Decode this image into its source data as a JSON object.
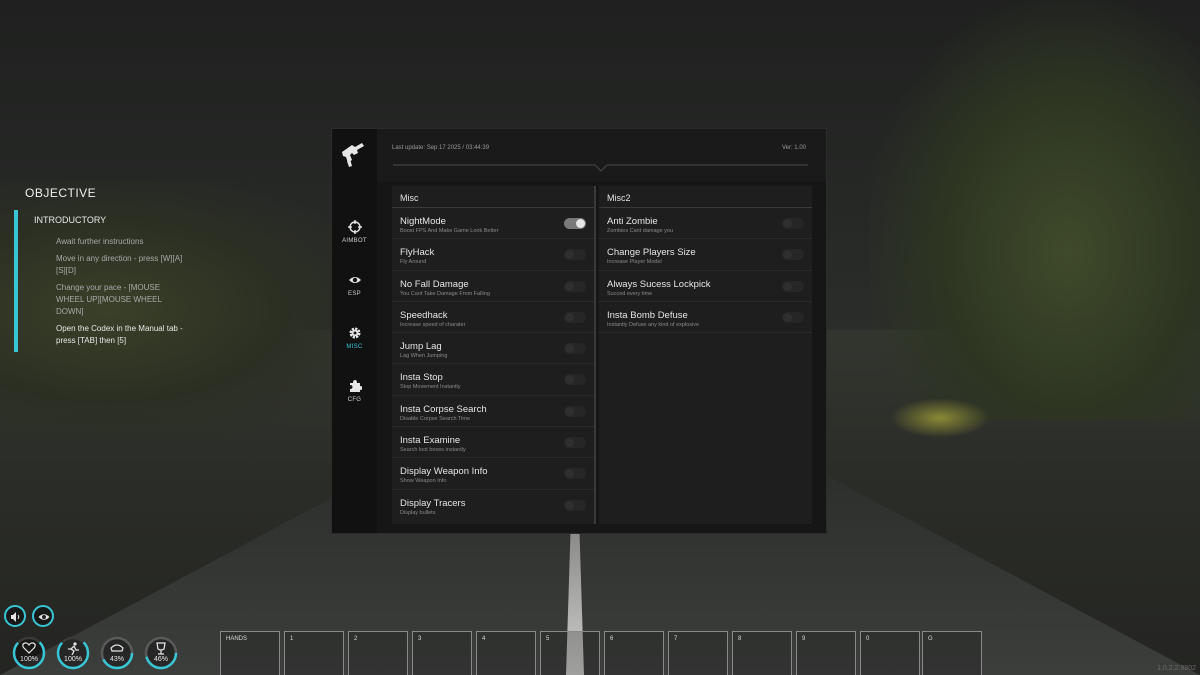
{
  "objective": {
    "title": "OBJECTIVE",
    "section": "INTRODUCTORY",
    "items": [
      "Await further instructions",
      "Move in any direction - press [W][A][S][D]",
      "Change your pace - [MOUSE WHEEL UP][MOUSE WHEEL DOWN]",
      "Open the Codex in the Manual tab - press [TAB] then [5]"
    ]
  },
  "menu": {
    "last_update": "Last update: Sep 17 2025 / 03:44:39",
    "version": "Ver: 1.00",
    "nav": [
      {
        "label": "AIMBOT",
        "icon": "crosshair-icon"
      },
      {
        "label": "ESP",
        "icon": "eye-icon"
      },
      {
        "label": "MISC",
        "icon": "gear-icon",
        "active": true
      },
      {
        "label": "CFG",
        "icon": "puzzle-icon"
      }
    ],
    "misc": {
      "title": "Misc",
      "options": [
        {
          "label": "NightMode",
          "desc": "Boost FPS And Make Game Look Better",
          "on": true
        },
        {
          "label": "FlyHack",
          "desc": "Fly Around",
          "on": false
        },
        {
          "label": "No Fall Damage",
          "desc": "You Cant Take Damage From Falling",
          "on": false
        },
        {
          "label": "Speedhack",
          "desc": "Increase speed of charater",
          "on": false
        },
        {
          "label": "Jump Lag",
          "desc": "Lag When Jumping",
          "on": false
        },
        {
          "label": "Insta Stop",
          "desc": "Stop Movement Instantly",
          "on": false
        },
        {
          "label": "Insta Corpse Search",
          "desc": "Disable Corpse Search Time",
          "on": false
        },
        {
          "label": "Insta Examine",
          "desc": "Search loot boxes instantly",
          "on": false
        },
        {
          "label": "Display Weapon Info",
          "desc": "Show Weapon Info",
          "on": false
        },
        {
          "label": "Display Tracers",
          "desc": "Display bullets",
          "on": false
        }
      ]
    },
    "misc2": {
      "title": "Misc2",
      "options": [
        {
          "label": "Anti Zombie",
          "desc": "Zombies Cant damage you",
          "on": false
        },
        {
          "label": "Change Players Size",
          "desc": "Increase Player Model",
          "on": false
        },
        {
          "label": "Always Sucess Lockpick",
          "desc": "Succed every time",
          "on": false
        },
        {
          "label": "Insta Bomb Defuse",
          "desc": "Instantly Defuse any kind of explosive",
          "on": false
        }
      ]
    }
  },
  "hud": {
    "stats": [
      {
        "name": "health",
        "icon": "heart-icon",
        "value": "100%"
      },
      {
        "name": "stamina",
        "icon": "running-icon",
        "value": "100%"
      },
      {
        "name": "food",
        "icon": "food-icon",
        "value": "43%"
      },
      {
        "name": "water",
        "icon": "drink-icon",
        "value": "46%"
      }
    ],
    "slots": [
      "HANDS",
      "1",
      "2",
      "3",
      "4",
      "5",
      "6",
      "7",
      "8",
      "9",
      "0",
      "G"
    ],
    "build": "1.0.2.2.9802"
  },
  "colors": {
    "accent": "#38c6d6",
    "panel": "#1a1a1a",
    "sidebar": "#111111"
  }
}
